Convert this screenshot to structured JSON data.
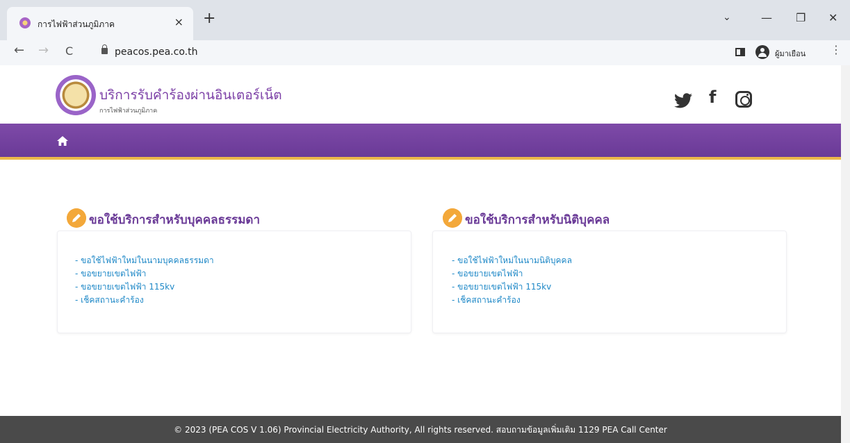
{
  "browser": {
    "tab_title": "การไฟฟ้าส่วนภูมิภาค",
    "tab_close": "×",
    "new_tab": "+",
    "window_minimize": "—",
    "window_maximize": "❐",
    "window_close": "✕",
    "window_dropdown": "⌄",
    "back": "←",
    "forward": "→",
    "reload": "C",
    "url": "peacos.pea.co.th",
    "profile_name": "ผู้มาเยือน",
    "menu": "⋮"
  },
  "header": {
    "title": "บริการรับคำร้องผ่านอินเตอร์เน็ต",
    "subtitle": "การไฟฟ้าส่วนภูมิภาค",
    "social": {
      "facebook": "f"
    }
  },
  "sections": [
    {
      "heading": "ขอใช้บริการสำหรับบุคคลธรรมดา",
      "links": [
        "- ขอใช้ไฟฟ้าใหม่ในนามบุคคลธรรมดา",
        "- ขอขยายเขตไฟฟ้า",
        "- ขอขยายเขตไฟฟ้า 115kv",
        "- เช็คสถานะคำร้อง"
      ]
    },
    {
      "heading": "ขอใช้บริการสำหรับนิติบุคคล",
      "links": [
        "- ขอใช้ไฟฟ้าใหม่ในนามนิติบุคคล",
        "- ขอขยายเขตไฟฟ้า",
        "- ขอขยายเขตไฟฟ้า 115kv",
        "- เช็คสถานะคำร้อง"
      ]
    }
  ],
  "footer": {
    "text": "© 2023 (PEA COS V 1.06) Provincial Electricity Authority, All rights reserved. สอบถามข้อมูลเพิ่มเติม 1129 PEA Call Center"
  },
  "colors": {
    "brand_purple": "#6a3a97",
    "accent_orange": "#f3a83a",
    "link_blue": "#1e88c7",
    "footer_gray": "#4a4a4a"
  },
  "icons": [
    "browser-tab-favicon",
    "lock-icon",
    "sidebar-icon",
    "profile-icon",
    "twitter-icon",
    "facebook-icon",
    "instagram-icon",
    "home-icon",
    "pencil-icon"
  ]
}
